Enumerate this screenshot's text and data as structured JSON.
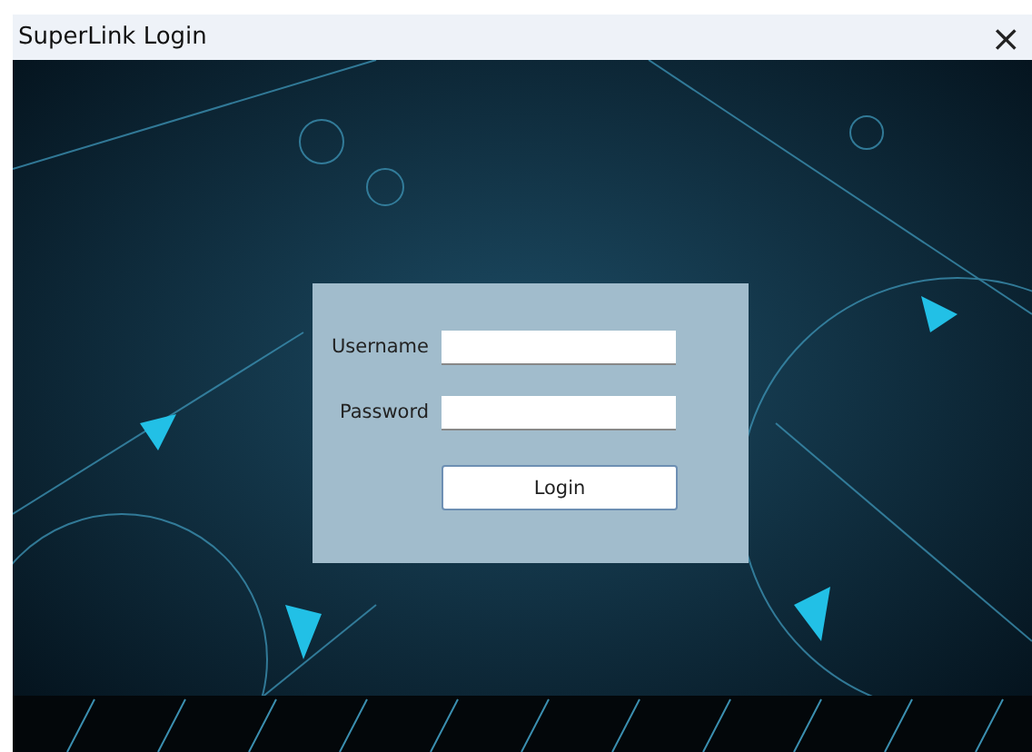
{
  "window": {
    "title": "SuperLink Login",
    "close": "×"
  },
  "form": {
    "fields": [
      {
        "label": "Username"
      },
      {
        "label": "Password"
      }
    ],
    "button": "Login"
  }
}
